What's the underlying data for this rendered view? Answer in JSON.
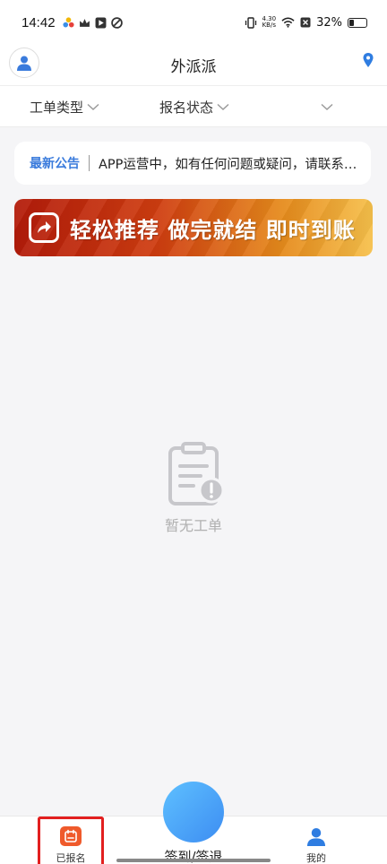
{
  "status_bar": {
    "time": "14:42",
    "net_speed_value": "4.30",
    "net_speed_unit": "KB/s",
    "battery_percent": "32%",
    "battery_level": 0.32
  },
  "header": {
    "title": "外派派"
  },
  "filters": [
    {
      "label": "工单类型"
    },
    {
      "label": "报名状态"
    },
    {
      "label": ""
    }
  ],
  "notice": {
    "tag": "最新公告",
    "text": "APP运营中，如有任何问题或疑问，请联系客服"
  },
  "banner": {
    "text": "轻松推荐 做完就结 即时到账"
  },
  "empty_state": {
    "text": "暂无工单"
  },
  "tab_bar": {
    "registered_label": "已报名",
    "checkin_label": "签到/签退",
    "mine_label": "我的"
  },
  "colors": {
    "accent_blue": "#3a7bdc",
    "highlight_red": "#e21f1f",
    "tab_orange": "#ef5a2b"
  }
}
